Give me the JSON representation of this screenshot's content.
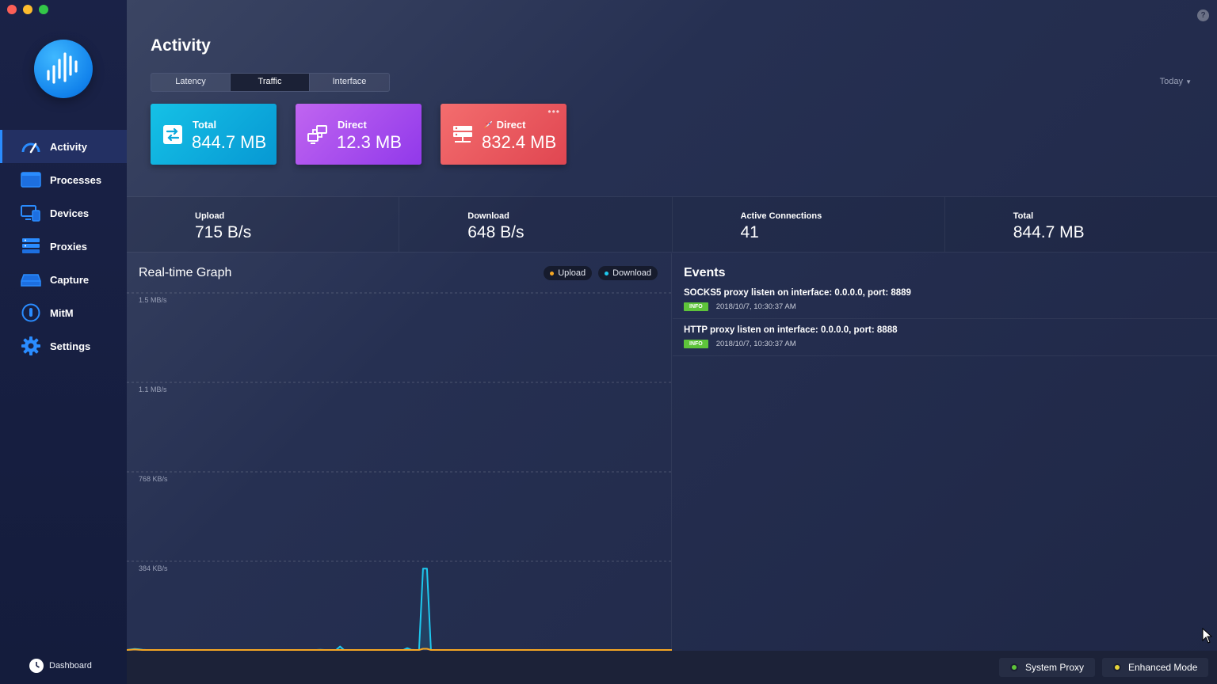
{
  "sidebar": {
    "logo_icon": "waveform-icon",
    "items": [
      {
        "label": "Activity",
        "icon": "speedometer-icon",
        "active": true
      },
      {
        "label": "Processes",
        "icon": "window-icon",
        "active": false
      },
      {
        "label": "Devices",
        "icon": "devices-icon",
        "active": false
      },
      {
        "label": "Proxies",
        "icon": "server-icon",
        "active": false
      },
      {
        "label": "Capture",
        "icon": "drive-icon",
        "active": false
      },
      {
        "label": "MitM",
        "icon": "lock-icon",
        "active": false
      },
      {
        "label": "Settings",
        "icon": "gear-icon",
        "active": false
      }
    ],
    "dashboard_label": "Dashboard"
  },
  "header": {
    "title": "Activity",
    "tabs": [
      {
        "label": "Latency",
        "active": false
      },
      {
        "label": "Traffic",
        "active": true
      },
      {
        "label": "Interface",
        "active": false
      }
    ],
    "range": "Today",
    "help": "?"
  },
  "cards": [
    {
      "label": "Total",
      "value": "844.7 MB",
      "icon": "swap-arrows-icon",
      "color": "#0aa8dc"
    },
    {
      "label": "Direct",
      "value": "12.3 MB",
      "icon": "network-icon",
      "color": "#a64cef"
    },
    {
      "label": "Direct",
      "value": "832.4 MB",
      "icon": "server-stack-icon",
      "badge_icon": "rocket-icon",
      "color": "#ea5a5f"
    }
  ],
  "stats": [
    {
      "label": "Upload",
      "value": "715 B/s"
    },
    {
      "label": "Download",
      "value": "648 B/s"
    },
    {
      "label": "Active Connections",
      "value": "41"
    },
    {
      "label": "Total",
      "value": "844.7 MB"
    }
  ],
  "graph": {
    "title": "Real-time Graph",
    "legend": [
      {
        "label": "Upload",
        "color": "#f5a623"
      },
      {
        "label": "Download",
        "color": "#1ec8ee"
      }
    ],
    "y_labels": [
      "1.5 MB/s",
      "1.1 MB/s",
      "768 KB/s",
      "384 KB/s"
    ]
  },
  "chart_data": {
    "type": "area",
    "title": "Real-time Graph",
    "ylim": [
      0,
      1536
    ],
    "y_unit": "KB/s",
    "series": [
      {
        "name": "Download",
        "color": "#1ec8ee",
        "values": [
          0,
          2,
          4,
          3,
          1,
          0,
          0,
          0,
          0,
          0,
          0,
          0,
          0,
          0,
          0,
          0,
          0,
          0,
          0,
          0,
          0,
          0,
          0,
          0,
          0,
          0,
          0,
          0,
          0,
          0,
          0,
          0,
          0,
          0,
          0,
          0,
          0,
          0,
          0,
          0,
          0,
          0,
          0,
          0,
          0,
          0,
          0,
          0,
          0,
          1,
          0,
          0,
          0,
          0,
          15,
          0,
          0,
          0,
          0,
          0,
          0,
          0,
          0,
          0,
          0,
          0,
          0,
          0,
          0,
          0,
          0,
          8,
          1,
          0,
          0,
          350,
          350,
          0,
          0,
          0,
          0,
          0,
          0,
          0,
          0,
          0,
          0,
          0,
          0,
          0,
          0,
          0,
          0,
          0,
          0,
          0,
          0,
          0,
          0,
          0,
          0,
          0,
          0,
          0,
          0,
          0,
          0,
          0,
          0,
          0,
          0,
          0,
          0,
          0,
          0,
          0,
          0,
          0,
          0,
          0,
          0,
          0,
          0,
          0,
          0,
          0,
          0,
          0,
          0,
          0,
          0,
          0,
          0,
          0,
          0,
          0,
          0,
          0,
          0
        ]
      },
      {
        "name": "Upload",
        "color": "#f5a623",
        "values": [
          0,
          1,
          2,
          1,
          0,
          0,
          0,
          0,
          0,
          0,
          0,
          0,
          0,
          0,
          0,
          0,
          0,
          0,
          0,
          0,
          0,
          0,
          0,
          0,
          0,
          0,
          0,
          0,
          0,
          0,
          0,
          0,
          0,
          0,
          0,
          0,
          0,
          0,
          0,
          0,
          0,
          0,
          0,
          0,
          0,
          0,
          0,
          0,
          0,
          0,
          0,
          0,
          0,
          0,
          0,
          0,
          0,
          0,
          0,
          0,
          0,
          0,
          0,
          0,
          0,
          0,
          0,
          0,
          0,
          0,
          0,
          0,
          0,
          0,
          0,
          5,
          5,
          0,
          0,
          0,
          0,
          0,
          0,
          0,
          0,
          0,
          0,
          0,
          0,
          0,
          0,
          0,
          0,
          0,
          0,
          0,
          0,
          0,
          0,
          0,
          0,
          0,
          0,
          0,
          0,
          0,
          0,
          0,
          0,
          0,
          0,
          0,
          0,
          0,
          0,
          0,
          0,
          0,
          0,
          0,
          0,
          0,
          0,
          0,
          0,
          0,
          0,
          0,
          0,
          0,
          0,
          0,
          0,
          0,
          0,
          0,
          0,
          0,
          0
        ]
      }
    ],
    "grid": true,
    "legend_position": "top-right"
  },
  "events": {
    "title": "Events",
    "items": [
      {
        "message": "SOCKS5 proxy listen on interface: 0.0.0.0, port: 8889",
        "level": "INFO",
        "time": "2018/10/7, 10:30:37 AM"
      },
      {
        "message": "HTTP proxy listen on interface: 0.0.0.0, port: 8888",
        "level": "INFO",
        "time": "2018/10/7, 10:30:37 AM"
      }
    ]
  },
  "footer": {
    "system_proxy": {
      "label": "System Proxy",
      "color": "#5ec43a"
    },
    "enhanced_mode": {
      "label": "Enhanced Mode",
      "color": "#e6d43a"
    }
  }
}
